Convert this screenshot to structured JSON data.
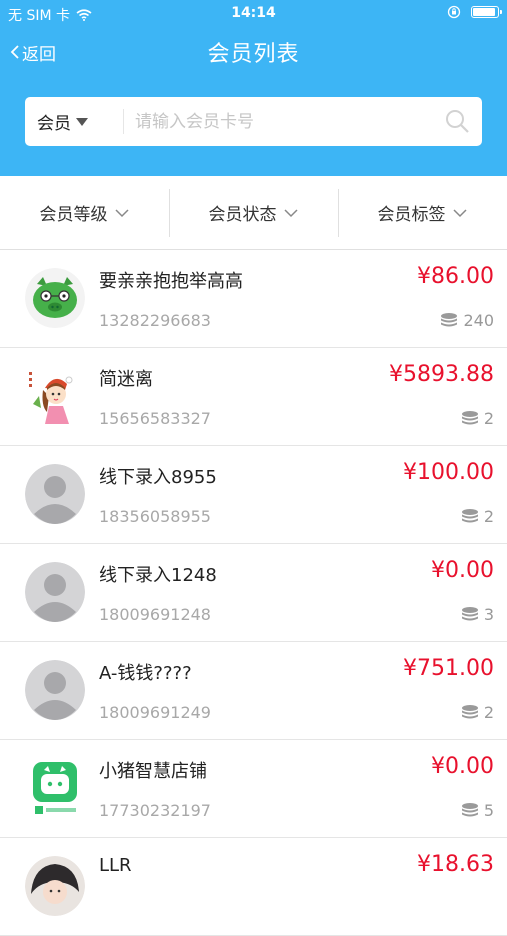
{
  "status_bar": {
    "carrier": "无 SIM 卡",
    "time": "14:14"
  },
  "nav": {
    "back_label": "返回",
    "title": "会员列表"
  },
  "search": {
    "type_label": "会员",
    "placeholder": "请输入会员卡号"
  },
  "filters": [
    {
      "label": "会员等级"
    },
    {
      "label": "会员状态"
    },
    {
      "label": "会员标签"
    }
  ],
  "colors": {
    "header": "#3db5f5",
    "amount": "#e8112d",
    "secondary_text": "#a8a8a8"
  },
  "members": [
    {
      "name": "要亲亲抱抱举高高",
      "phone": "13282296683",
      "amount": "¥86.00",
      "count": "240",
      "avatar": "green-pig-avatar"
    },
    {
      "name": "简迷离",
      "phone": "15656583327",
      "amount": "¥5893.88",
      "count": "2",
      "avatar": "cartoon-girl-avatar"
    },
    {
      "name": "线下录入8955",
      "phone": "18356058955",
      "amount": "¥100.00",
      "count": "2",
      "avatar": "default-avatar"
    },
    {
      "name": "线下录入1248",
      "phone": "18009691248",
      "amount": "¥0.00",
      "count": "3",
      "avatar": "default-avatar"
    },
    {
      "name": "A-钱钱????",
      "phone": "18009691249",
      "amount": "¥751.00",
      "count": "2",
      "avatar": "default-avatar"
    },
    {
      "name": "小猪智慧店铺",
      "phone": "17730232197",
      "amount": "¥0.00",
      "count": "5",
      "avatar": "pig-shop-logo-avatar"
    },
    {
      "name": "LLR",
      "phone": "",
      "amount": "¥18.63",
      "count": "",
      "avatar": "photo-avatar"
    }
  ]
}
